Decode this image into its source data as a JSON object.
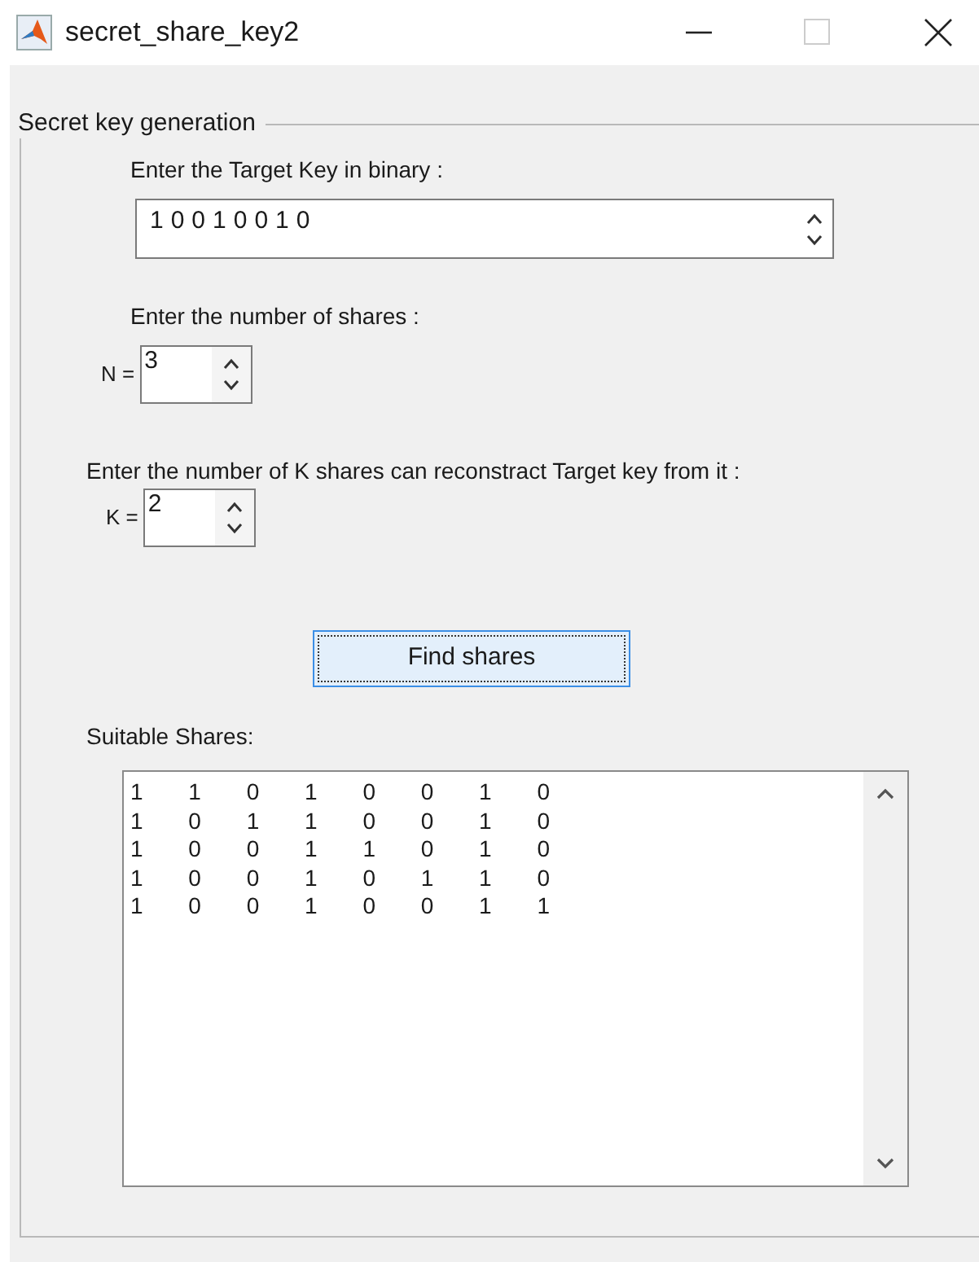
{
  "window": {
    "title": "secret_share_key2"
  },
  "panel": {
    "title": "Secret key generation"
  },
  "target_key": {
    "label": "Enter the Target Key in binary :",
    "value": "10010010"
  },
  "shares_count": {
    "label": "Enter the number of shares :",
    "prefix": "N =",
    "value": "3"
  },
  "threshold": {
    "label": "Enter the number of K shares can reconstract Target key from it :",
    "prefix": "K =",
    "value": "2"
  },
  "find_button": {
    "label": "Find shares",
    "focused": true
  },
  "result": {
    "label": "Suitable Shares:",
    "rows": [
      "1 1 0 1 0 0 1 0",
      "1 0 1 1 0 0 1 0",
      "1 0 0 1 1 0 1 0",
      "1 0 0 1 0 1 1 0",
      "1 0 0 1 0 0 1 1"
    ]
  }
}
